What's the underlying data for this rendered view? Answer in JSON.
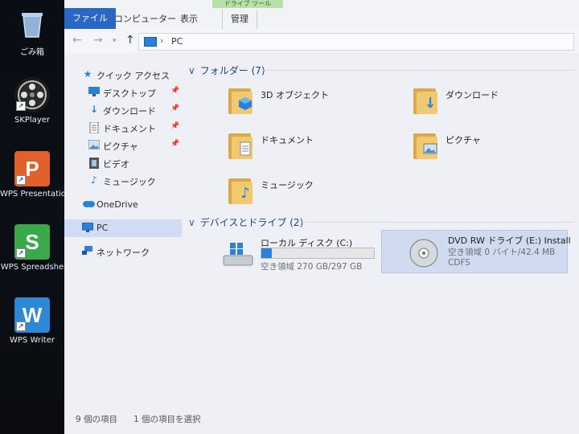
{
  "desktop": {
    "icons": [
      {
        "label": "ごみ箱",
        "icon": "recycle-bin-icon"
      },
      {
        "label": "SKPlayer",
        "icon": "film-reel-icon"
      },
      {
        "label": "WPS Presentatio",
        "icon": "wps-presentation-icon",
        "letter": "P",
        "color": "#e2612b"
      },
      {
        "label": "WPS Spreadshe",
        "icon": "wps-spreadsheet-icon",
        "letter": "S",
        "color": "#3aa94a"
      },
      {
        "label": "WPS Writer",
        "icon": "wps-writer-icon",
        "letter": "W",
        "color": "#2d88d6"
      }
    ]
  },
  "ribbon": {
    "tabs": [
      "ファイル",
      "コンピューター",
      "表示",
      "管理"
    ],
    "context_group": "ドライブ ツール"
  },
  "address": {
    "path": "PC"
  },
  "nav": {
    "items": [
      {
        "label": "クイック アクセス",
        "icon": "star-icon"
      },
      {
        "label": "デスクトップ",
        "icon": "desktop-icon",
        "pinned": true
      },
      {
        "label": "ダウンロード",
        "icon": "download-arrow-icon",
        "pinned": true
      },
      {
        "label": "ドキュメント",
        "icon": "document-icon",
        "pinned": true
      },
      {
        "label": "ピクチャ",
        "icon": "picture-icon",
        "pinned": true
      },
      {
        "label": "ビデオ",
        "icon": "video-icon"
      },
      {
        "label": "ミュージック",
        "icon": "music-note-icon"
      },
      {
        "label": "OneDrive",
        "icon": "cloud-icon"
      },
      {
        "label": "PC",
        "icon": "monitor-icon",
        "selected": true
      },
      {
        "label": "ネットワーク",
        "icon": "network-icon"
      }
    ]
  },
  "content": {
    "folders_header": "フォルダー (7)",
    "folders": [
      {
        "label": "3D オブジェクト",
        "icon": "3d-objects-folder-icon"
      },
      {
        "label": "ダウンロード",
        "icon": "downloads-folder-icon"
      },
      {
        "label": "ドキュメント",
        "icon": "documents-folder-icon"
      },
      {
        "label": "ピクチャ",
        "icon": "pictures-folder-icon"
      },
      {
        "label": "ミュージック",
        "icon": "music-folder-icon"
      }
    ],
    "devices_header": "デバイスとドライブ (2)",
    "drives": [
      {
        "name": "ローカル ディスク (C:)",
        "free": "空き領域 270 GB/297 GB",
        "icon": "windows-drive-icon",
        "used_fraction": 0.09
      },
      {
        "name": "DVD RW ドライブ (E:) Install",
        "free": "空き領域 0 バイト/42.4 MB",
        "fs": "CDFS",
        "icon": "optical-disc-icon"
      }
    ]
  },
  "status": {
    "count": "9 個の項目",
    "selected": "1 個の項目を選択"
  }
}
